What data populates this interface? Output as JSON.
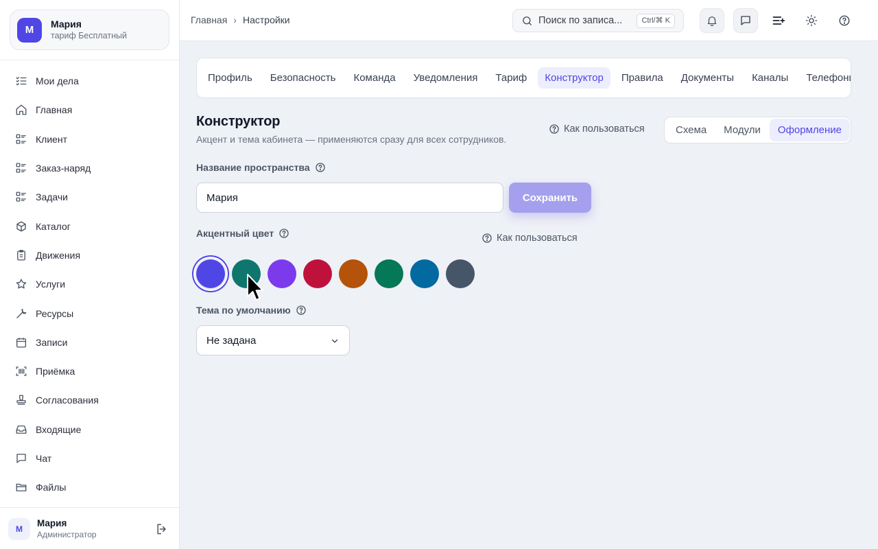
{
  "workspace": {
    "avatar": "М",
    "name": "Мария",
    "plan": "тариф Бесплатный"
  },
  "sidebar": {
    "items": [
      {
        "label": "Мои дела",
        "icon": "checklist-icon"
      },
      {
        "label": "Главная",
        "icon": "home-icon"
      },
      {
        "label": "Клиент",
        "icon": "list-icon"
      },
      {
        "label": "Заказ-наряд",
        "icon": "list-icon"
      },
      {
        "label": "Задачи",
        "icon": "list-icon"
      },
      {
        "label": "Каталог",
        "icon": "box-icon"
      },
      {
        "label": "Движения",
        "icon": "clipboard-icon"
      },
      {
        "label": "Услуги",
        "icon": "star-icon"
      },
      {
        "label": "Ресурсы",
        "icon": "wrench-icon"
      },
      {
        "label": "Записи",
        "icon": "calendar-icon"
      },
      {
        "label": "Приёмка",
        "icon": "barcode-scan-icon"
      },
      {
        "label": "Согласования",
        "icon": "stamp-icon"
      },
      {
        "label": "Входящие",
        "icon": "inbox-icon"
      },
      {
        "label": "Чат",
        "icon": "chat-icon"
      },
      {
        "label": "Файлы",
        "icon": "folder-icon"
      }
    ]
  },
  "user": {
    "avatar": "М",
    "name": "Мария",
    "role": "Администратор"
  },
  "breadcrumb": {
    "home": "Главная",
    "sep": "›",
    "current": "Настройки"
  },
  "search": {
    "placeholder": "Поиск по записям",
    "shown_text": "Поиск по записа...",
    "shortcut": "Ctrl/⌘ K"
  },
  "tabs": [
    "Профиль",
    "Безопасность",
    "Команда",
    "Уведомления",
    "Тариф",
    "Конструктор",
    "Правила",
    "Документы",
    "Каналы",
    "Телефония"
  ],
  "active_tab": "Конструктор",
  "page": {
    "title": "Конструктор",
    "subtitle": "Акцент и тема кабинета — применяются сразу для всех сотрудников.",
    "howto": "Как пользоваться"
  },
  "segments": [
    "Схема",
    "Модули",
    "Оформление"
  ],
  "active_segment": "Оформление",
  "workspace_name": {
    "label": "Название пространства",
    "value": "Мария",
    "save": "Сохранить"
  },
  "accent": {
    "label": "Акцентный цвет",
    "howto": "Как пользоваться",
    "colors": [
      "#4f46e5",
      "#0f766e",
      "#7c3aed",
      "#be123c",
      "#b45309",
      "#047857",
      "#0369a1",
      "#475569"
    ],
    "selected_index": 0
  },
  "theme": {
    "label": "Тема по умолчанию",
    "value": "Не задана"
  }
}
